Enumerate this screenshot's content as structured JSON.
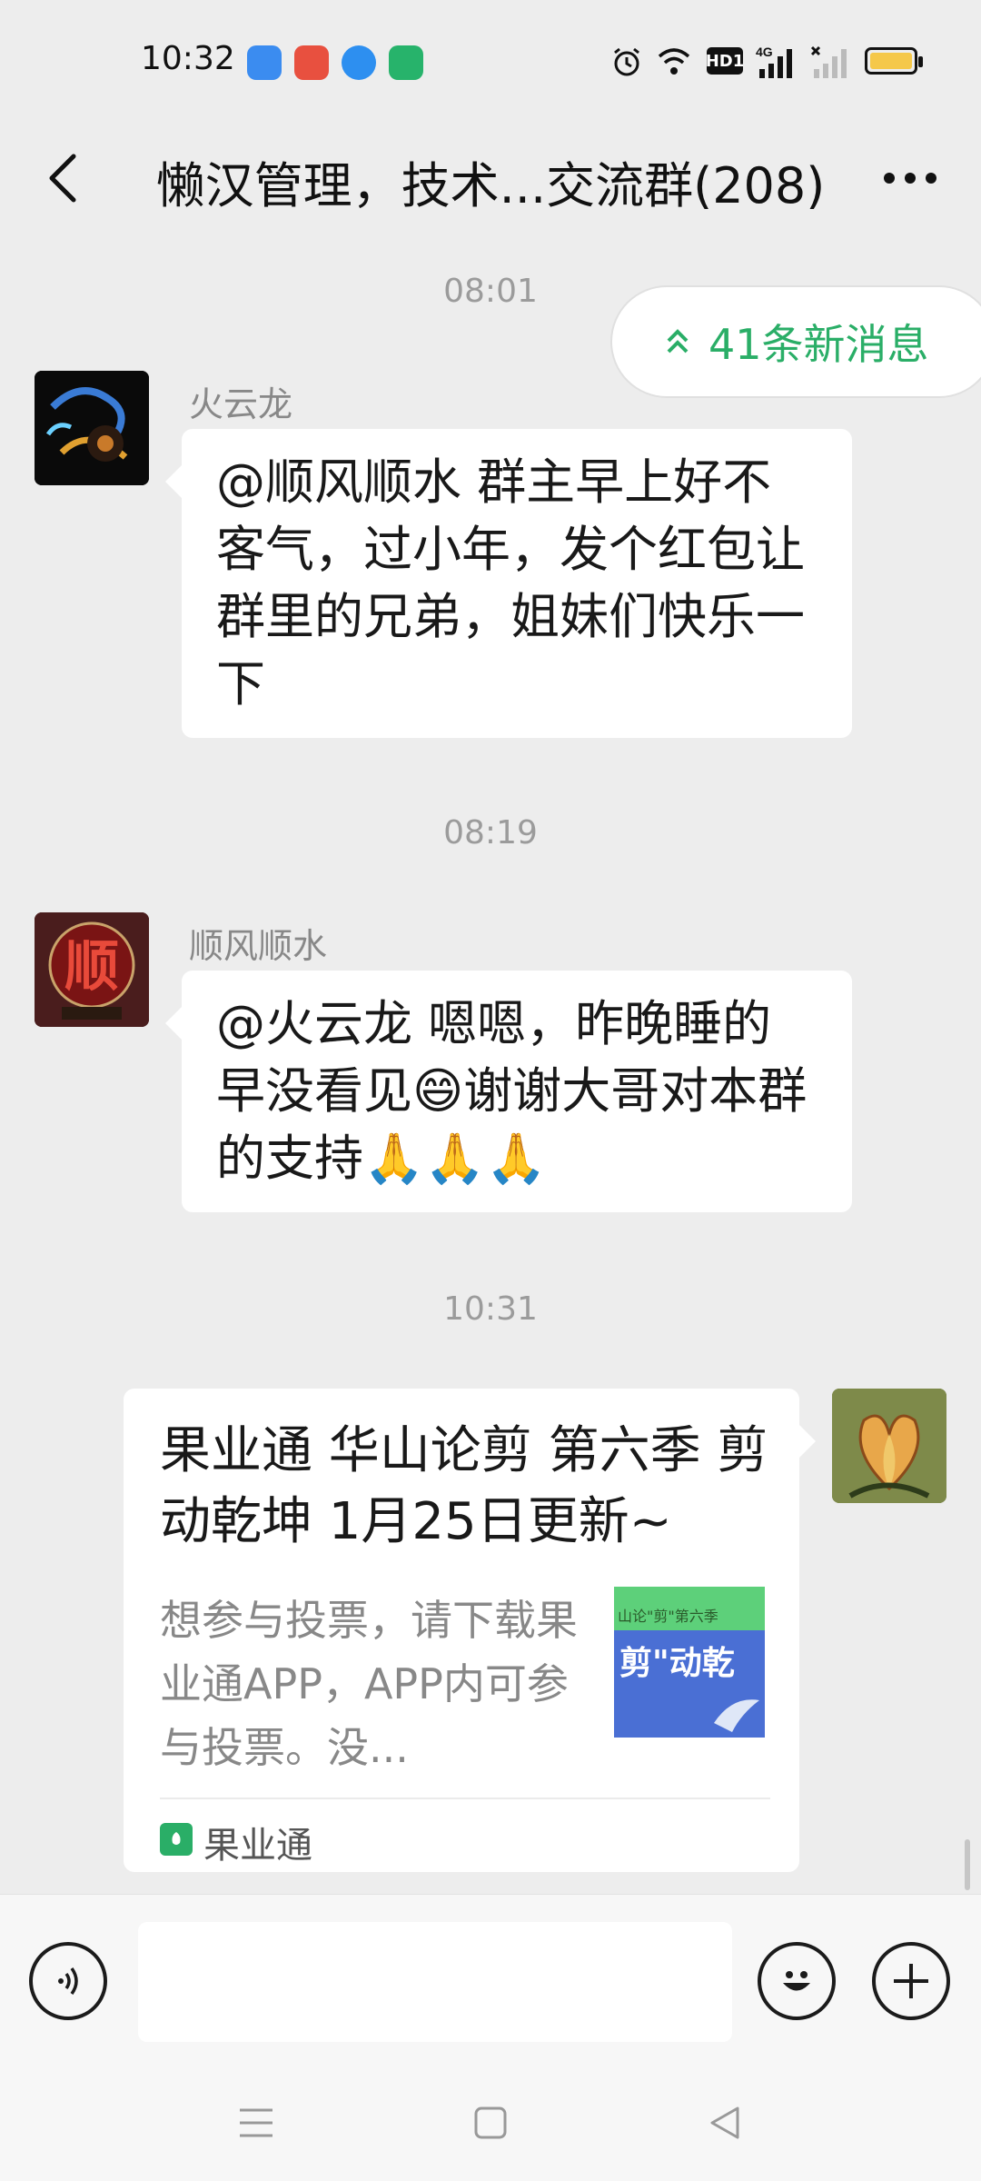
{
  "status_bar": {
    "time": "10:32",
    "app_icons": [
      "browser-icon",
      "red-app-icon",
      "blue-app-icon",
      "video-app-icon"
    ],
    "right_icons": [
      "alarm-icon",
      "wifi-icon",
      "hd-icon",
      "4g-signal-icon",
      "signal-icon",
      "battery-icon"
    ],
    "hd_label": "HD1",
    "network_label": "4G"
  },
  "header": {
    "title": "懒汉管理，技术...交流群(208)"
  },
  "new_messages_label": "41条新消息",
  "messages": [
    {
      "time": "08:01",
      "sender": "火云龙",
      "text": "@顺风顺水  群主早上好不客气，过小年，发个红包让群里的兄弟，姐妹们快乐一下"
    },
    {
      "time": "08:19",
      "sender": "顺风顺水",
      "avatar_char": "顺",
      "text": "@火云龙  嗯嗯，昨晚睡的早没看见😄谢谢大哥对本群的支持🙏🙏🙏"
    },
    {
      "time": "10:31",
      "card": {
        "title": "果业通 华山论剪 第六季 剪动乾坤 1月25日更新~",
        "description": "想参与投票，请下载果业通APP，APP内可参与投票。没...",
        "thumbnail_caption_top": "山论\"剪\"第六季",
        "thumbnail_caption_main": "剪\"动乾",
        "source": "果业通"
      }
    }
  ],
  "colors": {
    "accent_green": "#2aae67",
    "background": "#ededed"
  }
}
